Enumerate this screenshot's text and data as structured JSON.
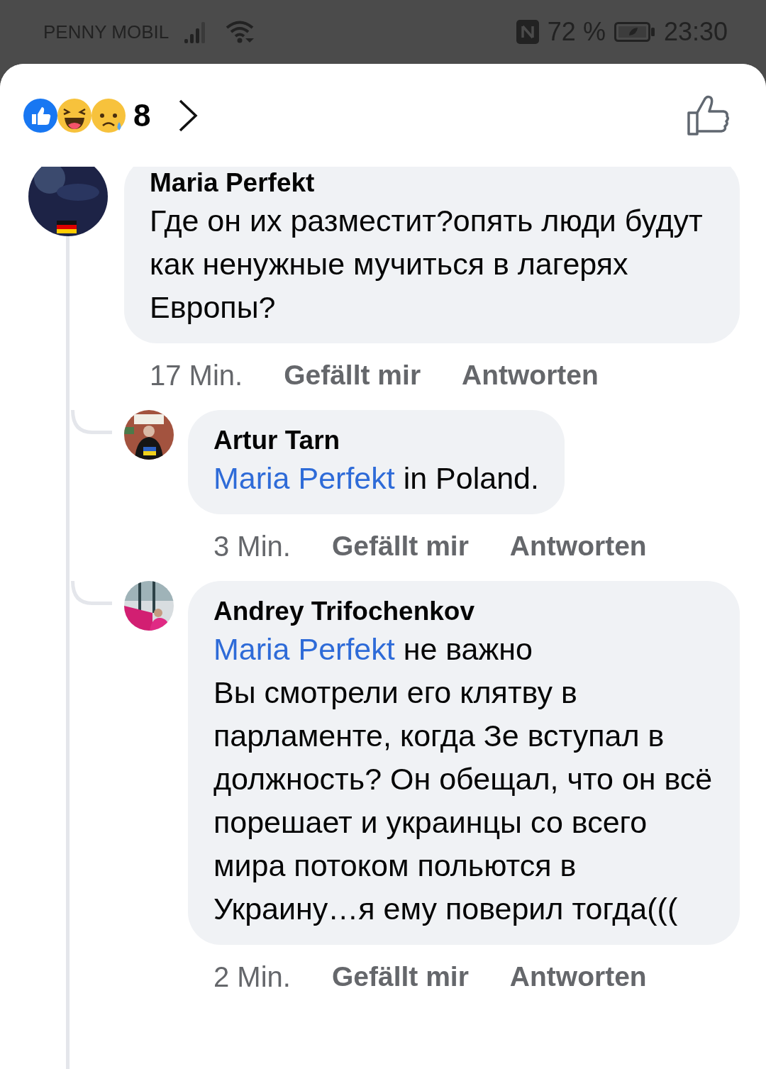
{
  "status_bar": {
    "carrier": "PENNY MOBIL",
    "battery_text": "72 %",
    "time": "23:30"
  },
  "header": {
    "reaction_count": "8"
  },
  "comment": {
    "author": "Maria Perfekt",
    "text": "Где он их разместит?опять люди будут как ненужные мучиться в лагерях Европы?",
    "time": "17 Min.",
    "like_label": "Gefällt mir",
    "reply_label": "Antworten",
    "children": [
      {
        "author": "Artur Tarn",
        "mention": "Maria Perfekt",
        "text": " in Poland.",
        "time": "3 Min.",
        "like_label": "Gefällt mir",
        "reply_label": "Antworten"
      },
      {
        "author": "Andrey Trifochenkov",
        "mention": "Maria Perfekt",
        "text": " не важно\nВы смотрели его клятву в парламенте, когда Зе вступал в должность? Он обещал, что он всё порешает и украинцы со всего мира потоком польются в Украину…я ему поверил тогда(((",
        "time": "2 Min.",
        "like_label": "Gefällt mir",
        "reply_label": "Antworten"
      }
    ]
  }
}
